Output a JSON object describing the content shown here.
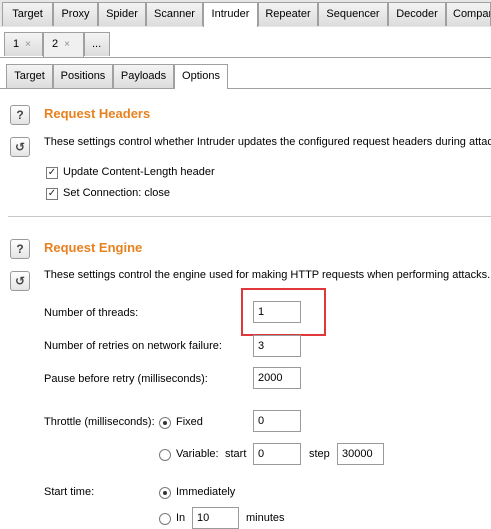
{
  "top_tabs": [
    "Target",
    "Proxy",
    "Spider",
    "Scanner",
    "Intruder",
    "Repeater",
    "Sequencer",
    "Decoder",
    "Comparer"
  ],
  "instance_tabs": {
    "tab1": "1",
    "tab2": "2",
    "more": "...",
    "close": "×"
  },
  "sub_tabs": [
    "Target",
    "Positions",
    "Payloads",
    "Options"
  ],
  "request_headers": {
    "title": "Request Headers",
    "description": "These settings control whether Intruder updates the configured request headers during attac",
    "update_content_length": "Update Content-Length header",
    "set_connection_close": "Set Connection: close"
  },
  "request_engine": {
    "title": "Request Engine",
    "description": "These settings control the engine used for making HTTP requests when performing attacks.",
    "threads_label": "Number of threads:",
    "threads_value": "1",
    "retries_label": "Number of retries on network failure:",
    "retries_value": "3",
    "pause_label": "Pause before retry (milliseconds):",
    "pause_value": "2000",
    "throttle_label": "Throttle (milliseconds):",
    "fixed_label": "Fixed",
    "fixed_value": "0",
    "variable_label": "Variable:",
    "start_label": "start",
    "start_value": "0",
    "step_label": "step",
    "step_value": "30000",
    "start_time_label": "Start time:",
    "immediately_label": "Immediately",
    "in_label": "In",
    "in_value": "10",
    "minutes_label": "minutes"
  },
  "icons": {
    "help": "help-icon",
    "reset": "reset-icon",
    "check": "checkmark-icon"
  },
  "colors": {
    "section_title": "#e8811f",
    "highlight": "#e0373b"
  }
}
